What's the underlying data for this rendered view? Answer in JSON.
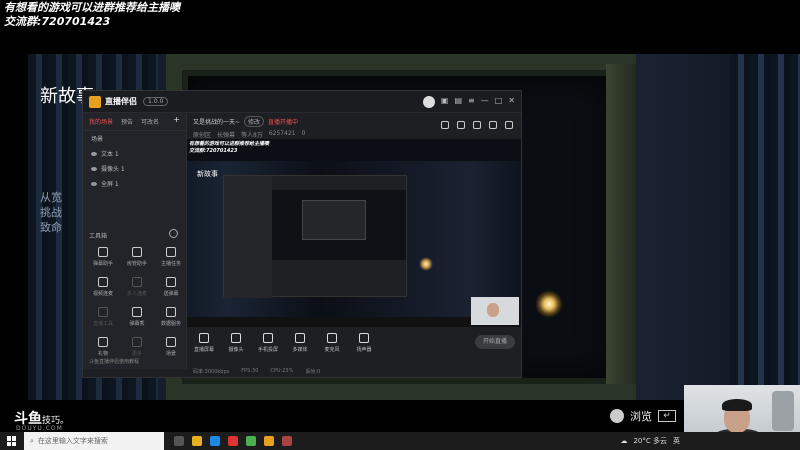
{
  "overlay": {
    "line1": "有想看的游戏可以进群推荐给主播噢",
    "line2": "交流群:720701423"
  },
  "scene": {
    "title": "新故事",
    "side_text": [
      "从宽",
      "挑战",
      "致命"
    ]
  },
  "brand": {
    "name": "斗鱼",
    "suffix": "技巧。",
    "sub": "DOUYU.COM"
  },
  "browse": {
    "label": "浏览"
  },
  "app": {
    "name": "直播伴侣",
    "version": "1.0.0",
    "left_tabs": [
      "我的场景",
      "预告",
      "可改名"
    ],
    "add_label": "+",
    "scene_group": "场景",
    "scene_items": [
      "文本 1",
      "摄像头 1",
      "全屏 1"
    ],
    "toolbox_title": "工具箱",
    "tools": [
      {
        "label": "弹幕助手",
        "icon": "danmaku-icon",
        "dim": false
      },
      {
        "label": "房管助手",
        "icon": "admin-icon",
        "dim": false
      },
      {
        "label": "主播任务",
        "icon": "task-icon",
        "dim": false
      },
      {
        "label": "视频连麦",
        "icon": "video-link-icon",
        "dim": false
      },
      {
        "label": "多人连麦",
        "icon": "multi-link-icon",
        "dim": true
      },
      {
        "label": "送弹幕",
        "icon": "gift-icon",
        "dim": false
      },
      {
        "label": "直播工具",
        "icon": "upload-icon",
        "dim": true
      },
      {
        "label": "弹幕秀",
        "icon": "tv-icon",
        "dim": false
      },
      {
        "label": "数据服务",
        "icon": "data-icon",
        "dim": false
      },
      {
        "label": "礼物",
        "icon": "present-icon",
        "dim": false
      },
      {
        "label": "更多",
        "icon": "more-icon",
        "dim": true
      },
      {
        "label": "场景",
        "icon": "scene-icon",
        "dim": false
      }
    ],
    "left_footer": "斗鱼直播伴侣使用教程",
    "room_title": "又是挑战的一天~",
    "edit_tag": "修改",
    "live_tag": "直播开播中",
    "meta": [
      "原创区",
      "长弹幕",
      "等人8万",
      "6257421",
      "0"
    ],
    "controls": [
      {
        "label": "直播屏幕",
        "icon": "screen-icon"
      },
      {
        "label": "摄像头",
        "icon": "camera-icon"
      },
      {
        "label": "手机投屏",
        "icon": "phone-icon"
      },
      {
        "label": "多媒体",
        "icon": "media-icon"
      },
      {
        "label": "麦克风",
        "icon": "mic-icon"
      },
      {
        "label": "扬声器",
        "icon": "speaker-icon"
      }
    ],
    "go_live": "开始直播",
    "status": [
      "码率:3000kbps",
      "FPS:30",
      "CPU:23%",
      "丢帧:0"
    ],
    "preview_overlay_1": "有想看的游戏可以进群推荐给主播噢",
    "preview_overlay_2": "交流群:720701423",
    "preview_title": "新故事"
  },
  "taskbar": {
    "search_placeholder": "在这里输入文字来搜索",
    "weather": "20°C 多云",
    "tray_extra": "英"
  }
}
